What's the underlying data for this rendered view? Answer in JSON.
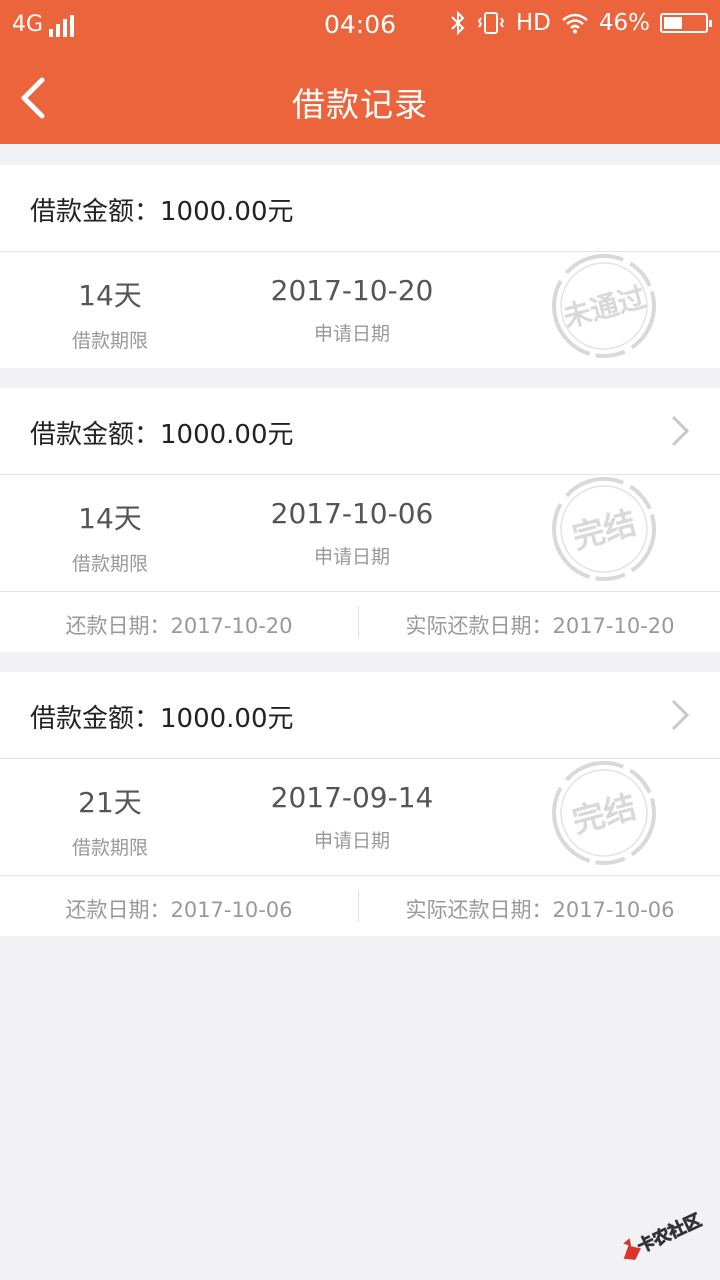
{
  "status_bar": {
    "network": "4G",
    "time": "04:06",
    "hd": "HD",
    "battery": "46%",
    "battery_level": 0.46
  },
  "nav": {
    "title": "借款记录"
  },
  "records": [
    {
      "amount": "借款金额：1000.00元",
      "term_value": "14天",
      "term_label": "借款期限",
      "date_value": "2017-10-20",
      "date_label": "申请日期",
      "stamp": "未通过"
    },
    {
      "amount": "借款金额：1000.00元",
      "term_value": "14天",
      "term_label": "借款期限",
      "date_value": "2017-10-06",
      "date_label": "申请日期",
      "stamp": "完结",
      "repay_date": "还款日期：2017-10-20",
      "actual_repay_date": "实际还款日期：2017-10-20"
    },
    {
      "amount": "借款金额：1000.00元",
      "term_value": "21天",
      "term_label": "借款期限",
      "date_value": "2017-09-14",
      "date_label": "申请日期",
      "stamp": "完结",
      "repay_date": "还款日期：2017-10-06",
      "actual_repay_date": "实际还款日期：2017-10-06"
    }
  ],
  "watermark": {
    "text": "卡农社区"
  },
  "colors": {
    "brand": "#ec643c",
    "background": "#f2f2f6",
    "stamp": "#d9d9d9"
  }
}
